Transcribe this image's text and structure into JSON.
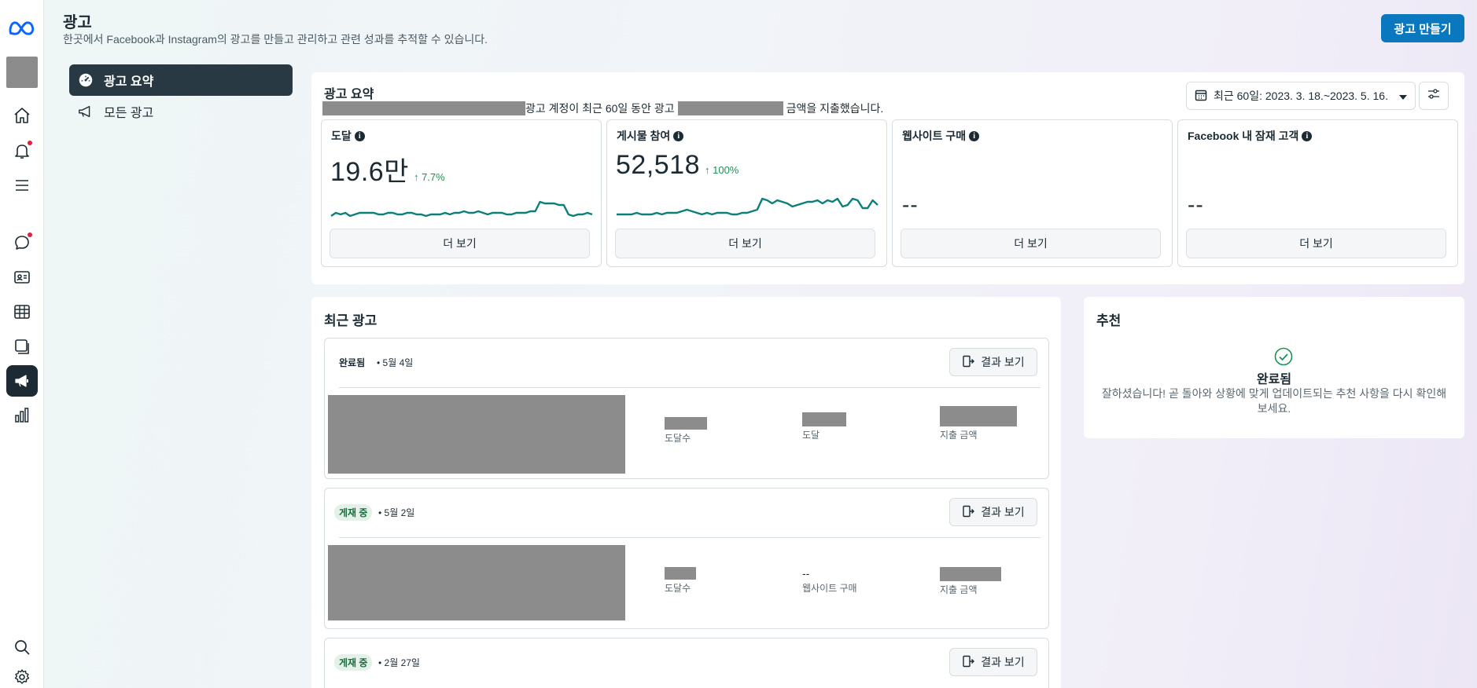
{
  "header": {
    "title": "광고",
    "subtitle": "한곳에서 Facebook과 Instagram의 광고를 만들고 관리하고 관련 성과를 추적할 수 있습니다.",
    "create_button": "광고 만들기"
  },
  "sidebar": {
    "items": [
      {
        "label": "광고 요약",
        "icon": "dashboard-icon",
        "active": true
      },
      {
        "label": "모든 광고",
        "icon": "megaphone-icon",
        "active": false
      }
    ]
  },
  "rail": {
    "icons": [
      "meta-logo",
      "avatar",
      "home-icon",
      "notifications-icon",
      "menu-icon",
      "messages-icon",
      "contacts-icon",
      "table-icon",
      "pages-icon",
      "ads-icon",
      "insights-icon",
      "search-icon",
      "settings-icon"
    ],
    "badge_color": "#e41e3f"
  },
  "summary": {
    "title": "광고 요약",
    "line_part1": "광고 계정이 최근 60일 동안 광고",
    "line_part2": "금액을 지출했습니다.",
    "date_range": "최근 60일: 2023. 3. 18.~2023. 5. 16.",
    "metrics": [
      {
        "label": "도달",
        "value": "19.6만",
        "change": "↑ 7.7%",
        "more": "더 보기",
        "has_chart": true,
        "trend": [
          3,
          5,
          4,
          5,
          3,
          4,
          5,
          5,
          5,
          5,
          4,
          4,
          5,
          5,
          4,
          4,
          5,
          5,
          4,
          4,
          3,
          4,
          4,
          4,
          5,
          4,
          5,
          5,
          6,
          5,
          5,
          6,
          5,
          4,
          5,
          5,
          5,
          4,
          4,
          5,
          5,
          5,
          6,
          6,
          12,
          11,
          11,
          11,
          10,
          10,
          4,
          3,
          4,
          4,
          5,
          4
        ]
      },
      {
        "label": "게시물 참여",
        "value": "52,518",
        "change": "↑ 100%",
        "more": "더 보기",
        "has_chart": true,
        "trend": [
          4,
          4,
          4,
          4,
          5,
          4,
          4,
          4,
          5,
          4,
          5,
          5,
          5,
          6,
          7,
          6,
          5,
          4,
          5,
          4,
          5,
          5,
          5,
          4,
          4,
          5,
          5,
          6,
          7,
          14,
          13,
          11,
          13,
          12,
          11,
          9,
          10,
          11,
          12,
          12,
          13,
          11,
          13,
          12,
          14,
          9,
          10,
          14,
          13,
          8,
          8,
          13,
          10
        ]
      },
      {
        "label": "웹사이트 구매",
        "value": "--",
        "more": "더 보기",
        "has_chart": false
      },
      {
        "label": "Facebook 내 잠재 고객",
        "value": "--",
        "more": "더 보기",
        "has_chart": false
      }
    ],
    "trend_color": "#0b7f78"
  },
  "recent": {
    "title": "최근 광고",
    "result_button": "결과 보기",
    "ads": [
      {
        "status": "완료됨",
        "date": "• 5월 4일",
        "stats": [
          "도달수",
          "도달",
          "지출 금액"
        ],
        "values": [
          "",
          "",
          ""
        ]
      },
      {
        "status": "게재 중",
        "date": "• 5월 2일",
        "stats": [
          "도달수",
          "웹사이트 구매",
          "지출 금액"
        ],
        "values": [
          "",
          "--",
          ""
        ]
      },
      {
        "status": "게재 중",
        "date": "• 2월 27일",
        "stats": [],
        "values": []
      }
    ]
  },
  "recommendations": {
    "title": "추천",
    "done": "완료됨",
    "message": "잘하셨습니다! 곧 돌아와 상황에 맞게 업데이트되는 추천 사항을 다시 확인해보세요."
  }
}
